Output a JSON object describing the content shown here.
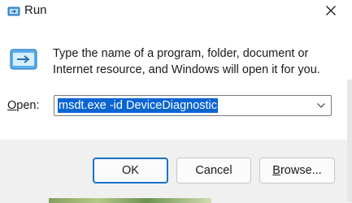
{
  "window": {
    "title": "Run",
    "title_icon": "run-dialog-icon",
    "close_icon": "close-icon"
  },
  "dialog": {
    "icon": "run-app-icon",
    "description": "Type the name of a program, folder, document or Internet resource, and Windows will open it for you.",
    "open_label_prefix": "O",
    "open_label_rest": "pen:",
    "combo_value": "msdt.exe -id DeviceDiagnostic",
    "dropdown_icon": "chevron-down-icon"
  },
  "buttons": {
    "ok_label": "OK",
    "cancel_label": "Cancel",
    "browse_label_prefix": "B",
    "browse_label_rest": "rowse..."
  },
  "colors": {
    "selection": "#0a64d2",
    "ok_border": "#1a72c9",
    "footer_bg": "#f0f0f0"
  }
}
